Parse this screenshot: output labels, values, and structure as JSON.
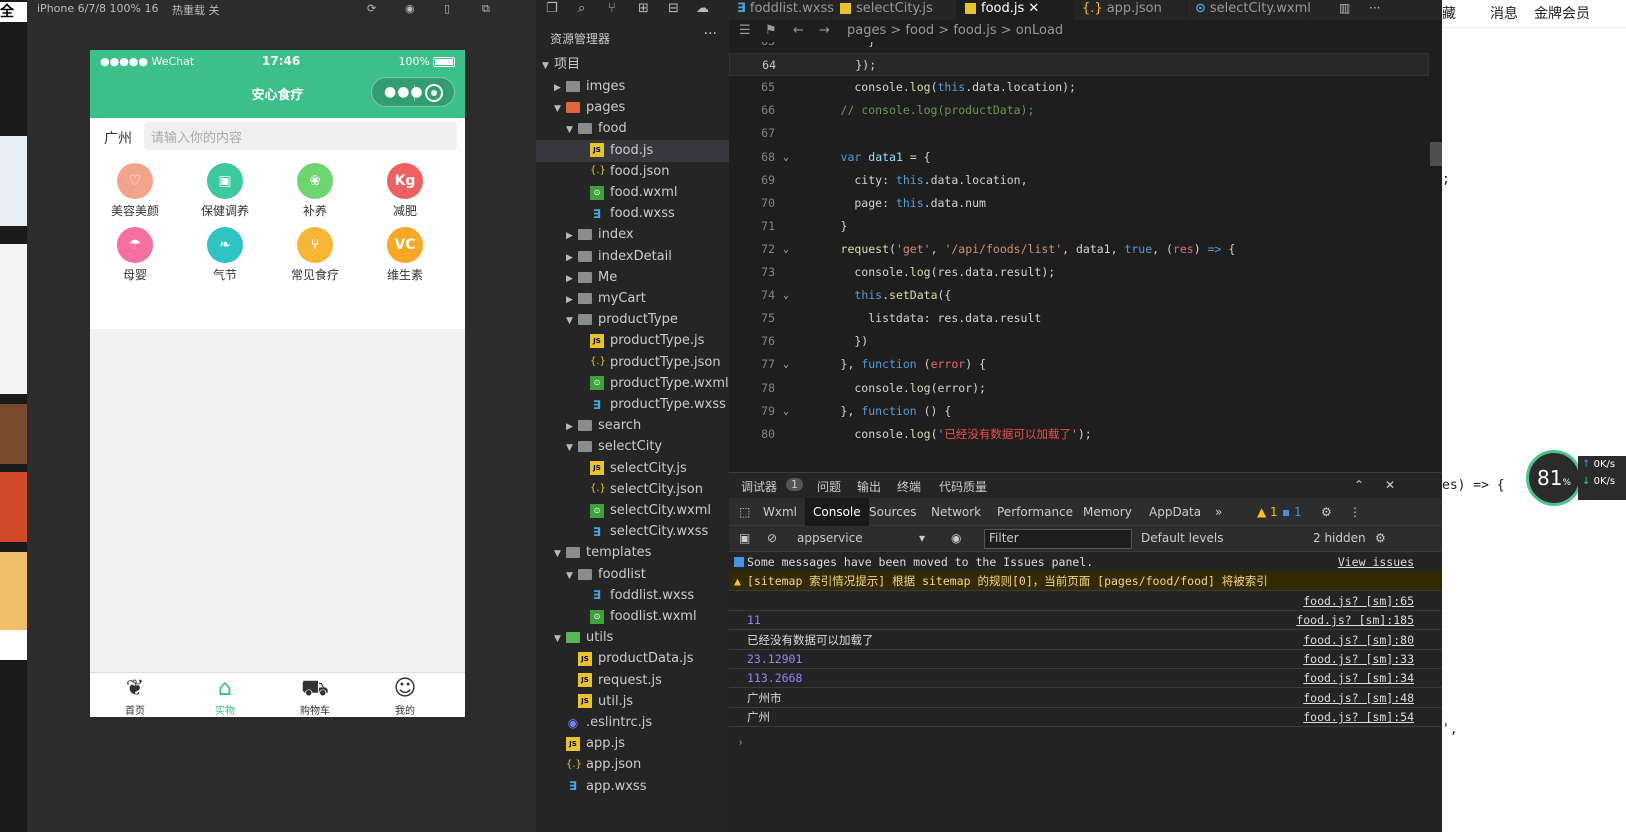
{
  "simulator_bar": {
    "device": "iPhone 6/7/8 100% 16",
    "hotreload": "热重载 关"
  },
  "left_strip": {
    "title_char": "全局"
  },
  "phone": {
    "carrier": "●●●●● WeChat",
    "time": "17:46",
    "battery": "100%",
    "title": "安心食疗",
    "city": "广州",
    "search_placeholder": "请输入你的内容",
    "categories": [
      {
        "label": "美容美颜",
        "icon": "leaf-icon",
        "color": "#f4a48c",
        "glyph": "♡"
      },
      {
        "label": "保健调养",
        "icon": "jar-icon",
        "color": "#3cc9a0",
        "glyph": "▣"
      },
      {
        "label": "补养",
        "icon": "grape-icon",
        "color": "#6fd66f",
        "glyph": "❀"
      },
      {
        "label": "减肥",
        "icon": "scale-icon",
        "color": "#f06060",
        "glyph": "Kg"
      },
      {
        "label": "母婴",
        "icon": "stroller-icon",
        "color": "#f56fa0",
        "glyph": "☂"
      },
      {
        "label": "气节",
        "icon": "leaf-icon",
        "color": "#2ec4c4",
        "glyph": "❧"
      },
      {
        "label": "常见食疗",
        "icon": "utensils-icon",
        "color": "#f6b535",
        "glyph": "⑂"
      },
      {
        "label": "维生素",
        "icon": "vitamin-icon",
        "color": "#f9a825",
        "glyph": "VC"
      }
    ],
    "tabs": [
      {
        "label": "首页",
        "icon": "leaf-outline-icon",
        "glyph": "❦"
      },
      {
        "label": "实物",
        "icon": "home-icon",
        "glyph": "⌂",
        "active": true
      },
      {
        "label": "购物车",
        "icon": "cart-icon",
        "glyph": "⛟"
      },
      {
        "label": "我的",
        "icon": "user-icon",
        "glyph": "☺"
      }
    ]
  },
  "explorer": {
    "title": "资源管理器",
    "more": "···",
    "project": "项目",
    "items": [
      {
        "label": "imges",
        "depth": 1,
        "type": "folder",
        "arrow": "▶"
      },
      {
        "label": "pages",
        "depth": 1,
        "type": "folder-red",
        "arrow": "▼"
      },
      {
        "label": "food",
        "depth": 2,
        "type": "folder",
        "arrow": "▼"
      },
      {
        "label": "food.js",
        "depth": 3,
        "type": "js",
        "selected": true
      },
      {
        "label": "food.json",
        "depth": 3,
        "type": "json"
      },
      {
        "label": "food.wxml",
        "depth": 3,
        "type": "wxml"
      },
      {
        "label": "food.wxss",
        "depth": 3,
        "type": "wxss"
      },
      {
        "label": "index",
        "depth": 2,
        "type": "folder",
        "arrow": "▶"
      },
      {
        "label": "indexDetail",
        "depth": 2,
        "type": "folder",
        "arrow": "▶"
      },
      {
        "label": "Me",
        "depth": 2,
        "type": "folder",
        "arrow": "▶"
      },
      {
        "label": "myCart",
        "depth": 2,
        "type": "folder",
        "arrow": "▶"
      },
      {
        "label": "productType",
        "depth": 2,
        "type": "folder",
        "arrow": "▼"
      },
      {
        "label": "productType.js",
        "depth": 3,
        "type": "js"
      },
      {
        "label": "productType.json",
        "depth": 3,
        "type": "json"
      },
      {
        "label": "productType.wxml",
        "depth": 3,
        "type": "wxml"
      },
      {
        "label": "productType.wxss",
        "depth": 3,
        "type": "wxss"
      },
      {
        "label": "search",
        "depth": 2,
        "type": "folder",
        "arrow": "▶"
      },
      {
        "label": "selectCity",
        "depth": 2,
        "type": "folder",
        "arrow": "▼"
      },
      {
        "label": "selectCity.js",
        "depth": 3,
        "type": "js"
      },
      {
        "label": "selectCity.json",
        "depth": 3,
        "type": "json"
      },
      {
        "label": "selectCity.wxml",
        "depth": 3,
        "type": "wxml"
      },
      {
        "label": "selectCity.wxss",
        "depth": 3,
        "type": "wxss"
      },
      {
        "label": "templates",
        "depth": 1,
        "type": "folder",
        "arrow": "▼"
      },
      {
        "label": "foodlist",
        "depth": 2,
        "type": "folder",
        "arrow": "▼"
      },
      {
        "label": "foddlist.wxss",
        "depth": 3,
        "type": "wxss"
      },
      {
        "label": "foodlist.wxml",
        "depth": 3,
        "type": "wxml"
      },
      {
        "label": "utils",
        "depth": 1,
        "type": "folder-green",
        "arrow": "▼"
      },
      {
        "label": "productData.js",
        "depth": 2,
        "type": "js"
      },
      {
        "label": "request.js",
        "depth": 2,
        "type": "js"
      },
      {
        "label": "util.js",
        "depth": 2,
        "type": "js"
      },
      {
        "label": ".eslintrc.js",
        "depth": 1,
        "type": "esl"
      },
      {
        "label": "app.js",
        "depth": 1,
        "type": "js"
      },
      {
        "label": "app.json",
        "depth": 1,
        "type": "json"
      },
      {
        "label": "app.wxss",
        "depth": 1,
        "type": "wxss"
      }
    ]
  },
  "editor": {
    "tabs": [
      {
        "label": "foddlist.wxss",
        "kind": "wxss"
      },
      {
        "label": "selectCity.js",
        "kind": "js"
      },
      {
        "label": "food.js",
        "kind": "js",
        "active": true
      },
      {
        "label": "app.json",
        "kind": "json"
      },
      {
        "label": "selectCity.wxml",
        "kind": "wxml"
      }
    ],
    "breadcrumbs": [
      "pages",
      "food",
      "food.js",
      "onLoad"
    ],
    "lines": [
      {
        "n": "63",
        "html": "          }"
      },
      {
        "n": "64",
        "html": "        });",
        "current": true
      },
      {
        "n": "65",
        "html": "        console.<span class='f'>log</span>(<span class='t'>this</span>.data.location);"
      },
      {
        "n": "66",
        "html": "      <span class='c'>// console.log(productData);</span>"
      },
      {
        "n": "67",
        "html": ""
      },
      {
        "n": "68",
        "html": "      <span class='t'>var</span> <span class='v'>data1</span> = {",
        "fold": true
      },
      {
        "n": "69",
        "html": "        city: <span class='t'>this</span>.data.location,"
      },
      {
        "n": "70",
        "html": "        page: <span class='t'>this</span>.data.num"
      },
      {
        "n": "71",
        "html": "      }"
      },
      {
        "n": "72",
        "html": "      <span class='f'>request</span>(<span class='s'>'get'</span>, <span class='s'>'/api/foods/list'</span>, data1, <span class='t'>true</span>, (<span class='p'>res</span>) <span class='t'>=&gt;</span> {",
        "fold": true
      },
      {
        "n": "73",
        "html": "        console.<span class='f'>log</span>(res.data.result);"
      },
      {
        "n": "74",
        "html": "        <span class='t'>this</span>.<span class='f'>setData</span>({",
        "fold": true
      },
      {
        "n": "75",
        "html": "          listdata: res.data.result"
      },
      {
        "n": "76",
        "html": "        })"
      },
      {
        "n": "77",
        "html": "      }, <span class='t'>function</span> (<span class='p'>error</span>) {",
        "fold": true
      },
      {
        "n": "78",
        "html": "        console.<span class='f'>log</span>(error);"
      },
      {
        "n": "79",
        "html": "      }, <span class='t'>function</span> () {",
        "fold": true
      },
      {
        "n": "80",
        "html": "        console.<span class='f'>log</span>(<span class='s'>'</span><span class='sr'>已经没有数据可以加载了</span><span class='s'>'</span>);"
      }
    ]
  },
  "devtools": {
    "top": {
      "debugger": "调试器",
      "count": "1",
      "issues": "问题",
      "output": "输出",
      "terminal": "终端",
      "quality": "代码质量"
    },
    "tabs": [
      "Wxml",
      "Console",
      "Sources",
      "Network",
      "Performance",
      "Memory",
      "AppData"
    ],
    "active_tab": "Console",
    "warn_count": "1",
    "info_count": "1",
    "context": "appservice",
    "filter_placeholder": "Filter",
    "levels": "Default levels",
    "hidden": "2 hidden",
    "messages": [
      {
        "text": "Some messages have been moved to the Issues panel.",
        "src": "View issues",
        "kind": "info"
      },
      {
        "text": "[sitemap 索引情况提示] 根据 sitemap 的规则[0]，当前页面 [pages/food/food] 将被索引",
        "src": "",
        "kind": "warn"
      },
      {
        "text": "",
        "src": "food.js? [sm]:65",
        "kind": "log"
      },
      {
        "text": "11",
        "src": "food.js? [sm]:185",
        "kind": "num"
      },
      {
        "text": "已经没有数据可以加载了",
        "src": "food.js? [sm]:80",
        "kind": "log"
      },
      {
        "text": "23.12901",
        "src": "food.js? [sm]:33",
        "kind": "num"
      },
      {
        "text": "113.2668",
        "src": "food.js? [sm]:34",
        "kind": "num"
      },
      {
        "text": "广州市",
        "src": "food.js? [sm]:48",
        "kind": "log"
      },
      {
        "text": "广州",
        "src": "food.js? [sm]:54",
        "kind": "log"
      }
    ],
    "prompt": "›"
  },
  "right_window": {
    "cang": "藏",
    "messages": "消息",
    "vip": "金牌会员",
    "frag1": ";",
    "frag2": "es) => {",
    "frag3": "',",
    "perf_value": "81",
    "perf_unit": "%",
    "speed_up": "0K/s",
    "speed_down": "0K/s"
  }
}
